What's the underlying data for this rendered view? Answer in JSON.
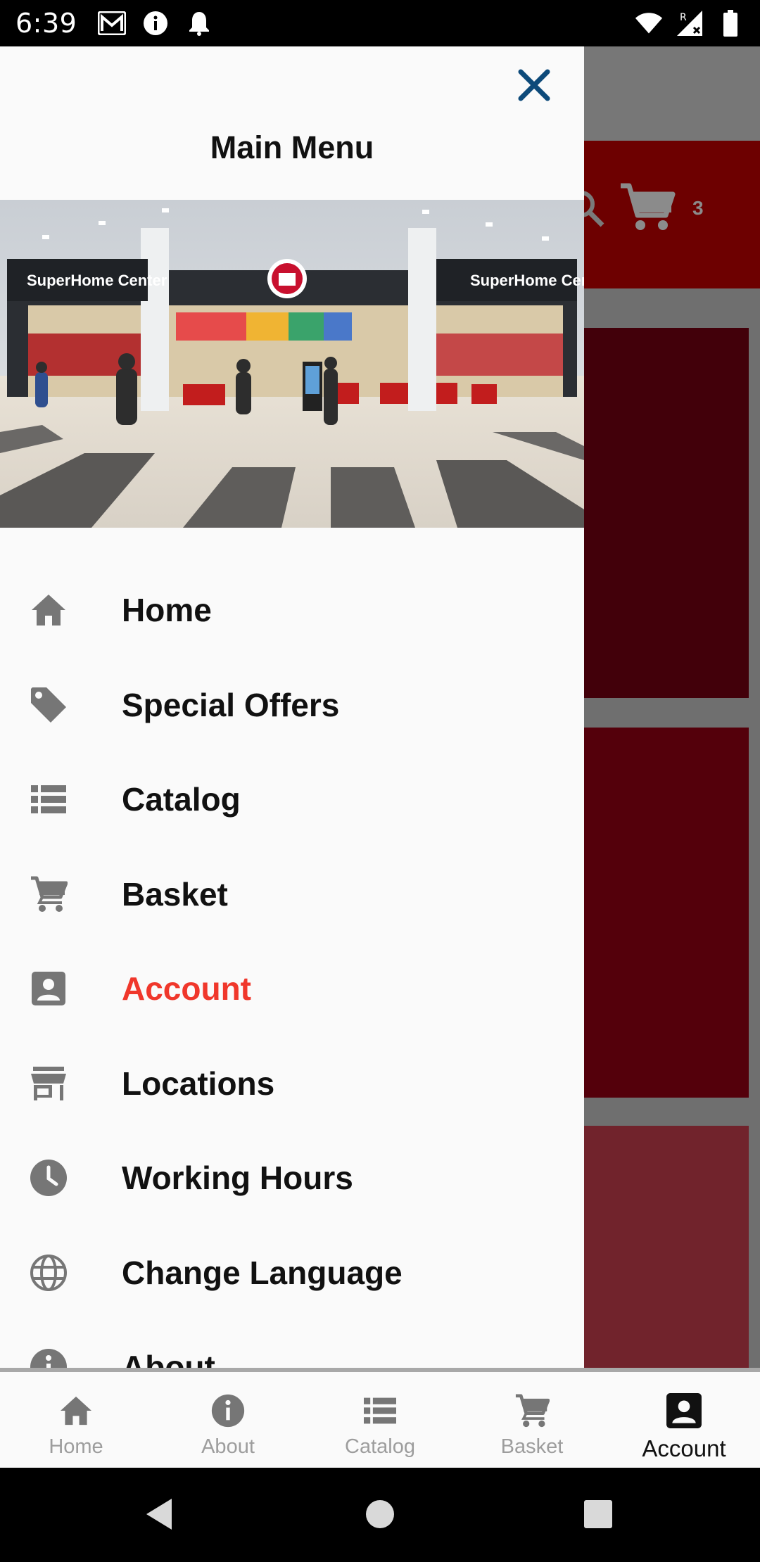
{
  "status_bar": {
    "time": "6:39",
    "icons_left": [
      "gmail-icon",
      "info-icon",
      "notification-bell-icon"
    ],
    "icons_right": [
      "wifi-icon",
      "signal-roaming-icon",
      "battery-icon"
    ]
  },
  "background": {
    "cart_count": "3",
    "colors": {
      "header": "#6d0000",
      "card1": "#42000a",
      "card2": "#54000b",
      "card3": "#71232c"
    }
  },
  "drawer": {
    "title": "Main Menu",
    "close_icon": "close-icon",
    "image_alt": "SuperHome Center store entrance",
    "image_signs": {
      "left": "SuperHome Center",
      "right": "SuperHome Center"
    },
    "menu": [
      {
        "label": "Home",
        "icon": "home-icon"
      },
      {
        "label": "Special Offers",
        "icon": "tag-icon"
      },
      {
        "label": "Catalog",
        "icon": "list-icon"
      },
      {
        "label": "Basket",
        "icon": "cart-icon"
      },
      {
        "label": "Account",
        "icon": "account-box-icon",
        "active": true
      },
      {
        "label": "Locations",
        "icon": "store-icon"
      },
      {
        "label": "Working Hours",
        "icon": "clock-icon"
      },
      {
        "label": "Change Language",
        "icon": "globe-icon"
      },
      {
        "label": "About",
        "icon": "info-icon"
      }
    ],
    "active_color": "#f0372b"
  },
  "bottom_nav": {
    "items": [
      {
        "label": "Home",
        "icon": "home-icon"
      },
      {
        "label": "About",
        "icon": "info-icon"
      },
      {
        "label": "Catalog",
        "icon": "list-icon"
      },
      {
        "label": "Basket",
        "icon": "cart-icon"
      },
      {
        "label": "Account",
        "icon": "account-box-icon",
        "active": true
      }
    ]
  },
  "system_nav": {
    "buttons": [
      "back-icon",
      "home-circle-icon",
      "recents-icon"
    ]
  }
}
